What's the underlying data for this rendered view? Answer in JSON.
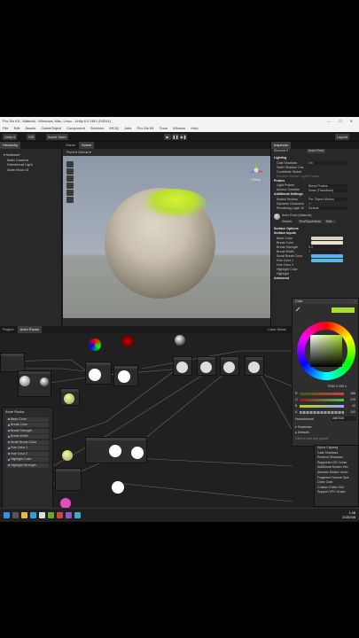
{
  "window": {
    "title": "Pro-Sis Kit - Material - Windows, Mac, Linux - Unity 6.0.26f1 (D3D11)",
    "controls": "— ☐ ✕"
  },
  "menu": [
    "File",
    "Edit",
    "Assets",
    "GameObject",
    "Component",
    "Services",
    "MCIQ",
    "Jobs",
    "Pro-Sis Kit",
    "Tools",
    "Window",
    "Help"
  ],
  "toolbar": {
    "account": "Unity 6",
    "sis": "SIS",
    "asset_store": "Asset Store",
    "play": "▶",
    "pause": "❚❚",
    "step": "▶❚",
    "layout": "Layout"
  },
  "hierarchy": {
    "tab": "Hierarchy",
    "items": [
      "▾ Material*",
      "Main Camera",
      "Directional Light",
      "Anim Rock 01"
    ]
  },
  "scene": {
    "tabs": [
      "Game",
      "Scene"
    ],
    "tools_left": "Pivot ▾  Global ▾",
    "gizmo_label": "< Persp"
  },
  "inspector": {
    "tabs": [
      "Inspector"
    ],
    "header_left": "Element 0",
    "header_right": "Anim Rock",
    "lighting_title": "Lighting",
    "lighting": [
      {
        "label": "Cast Shadows",
        "value": "On"
      },
      {
        "label": "Static Shadow Cas",
        "value": ""
      },
      {
        "label": "Contribute Global",
        "value": ""
      },
      {
        "label": "",
        "value": "Receive Global I  Light Probes"
      }
    ],
    "probes_title": "Probes",
    "probes": [
      {
        "label": "Light Probes",
        "value": "Blend Probes"
      },
      {
        "label": "Anchor Override",
        "value": "None (Transform)"
      }
    ],
    "additional_title": "Additional Settings",
    "additional": [
      {
        "label": "Motion Vectors",
        "value": "Per Object Motion"
      },
      {
        "label": "Dynamic Occlusion",
        "value": "✓"
      },
      {
        "label": "Rendering Layer M",
        "value": "Default"
      }
    ],
    "material_name": "Anim Rock (Material)",
    "shader_label": "Shader",
    "shader_value": "Pro/Top/Anime",
    "edit_label": "Edit...",
    "surface_options": "Surface Options",
    "surface_inputs": "Surface Inputs",
    "inputs": [
      {
        "label": "Base Color",
        "color": "#d9d2c0"
      },
      {
        "label": "Break Color",
        "color": "#e9e2d0"
      },
      {
        "label": "Break Strength",
        "value": "0.1"
      },
      {
        "label": "Break Width",
        "value": "1"
      },
      {
        "label": "Small Break Color",
        "color": "#58b7e8"
      },
      {
        "label": "Hue Color 1",
        "color": "#58b7e8"
      },
      {
        "label": "Hue Color 2",
        "color": ""
      },
      {
        "label": "Highlight Color",
        "color": ""
      },
      {
        "label": "Highlight",
        "color": ""
      }
    ],
    "advanced": "Advanced"
  },
  "graph": {
    "tabs": [
      "Project",
      "Anim Rocks"
    ],
    "color_mode": "Color Mode",
    "blackboard_title": "Anim Rocks",
    "blackboard_items": [
      "Base Color",
      "Break Color",
      "Break Strength",
      "Break Width",
      "Small Break Color",
      "Hue Color 1",
      "Hue Color 2",
      "Highlight Color",
      "Highlight Strength"
    ]
  },
  "picker": {
    "title": "Color",
    "mode": "RGB 0-255 ▾",
    "sliders": [
      {
        "label": "R",
        "value": "168",
        "color": "#e03c3c"
      },
      {
        "label": "G",
        "value": "225",
        "color": "#3cd03c"
      },
      {
        "label": "B",
        "value": "42",
        "color": "#d0c03c"
      },
      {
        "label": "A",
        "value": "100",
        "color": "#999999"
      }
    ],
    "hex_label": "Hexadecimal",
    "hex_value": "A8E02A",
    "presets": "▾ Swatches",
    "defaults": "▸ Defaults",
    "hint": "Click to add new preset",
    "current_color": "#a8e02a"
  },
  "dropdown": {
    "items": [
      "Alpha Clipping",
      "Cast Shadows",
      "Receive Shadows",
      "Supports LOD Cross",
      "Additional Motion Vec",
      "Alembic Motion Vecto",
      "Fragment Normal Spa",
      "Clear Coat",
      "Custom Editor GUI",
      "Support VFX Graph"
    ]
  },
  "taskbar": {
    "time": "1:38",
    "date": "2025/4/8"
  }
}
